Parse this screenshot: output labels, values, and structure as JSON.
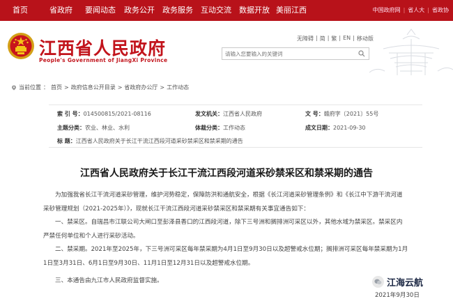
{
  "topnav": {
    "items": [
      "首页",
      "省政府",
      "要闻动态",
      "政务公开",
      "政务服务",
      "互动交流",
      "数据开放",
      "美丽江西"
    ],
    "right": [
      "中国政府网",
      "省人大",
      "省政协"
    ]
  },
  "header": {
    "title": "江西省人民政府",
    "subtitle": "People's Government of JiangXi Province",
    "toplinks": [
      "无障碍",
      "简",
      "繁",
      "EN",
      "移动版"
    ],
    "search_placeholder": "请输入您要输入的关键词"
  },
  "breadcrumb": {
    "current_label": "当前位置",
    "items": [
      "首页",
      "政府信息公开目录",
      "省政府办公厅",
      "工作动态"
    ]
  },
  "meta": {
    "index_label": "索 引 号：",
    "index_value": "014500815/2021-08116",
    "issuer_label": "发文机关：",
    "issuer_value": "江西省人民政府",
    "docno_label": "文 号：",
    "docno_value": "赣府字〔2021〕55号",
    "topic_label": "主题分类：",
    "topic_value": "农业、林业、水利",
    "category_label": "体裁分类：",
    "category_value": "工作动态",
    "date_label": "成文日期：",
    "date_value": "2021-09-30",
    "title_label": "标 题：",
    "title_value": "江西省人民政府关于长江干流江西段河道采砂禁采区和禁采期的通告"
  },
  "article": {
    "title": "江西省人民政府关于长江干流江西段河道采砂禁采区和禁采期的通告",
    "p1_line1": "为加强我省长江干流河道采砂管理，维护河势稳定，保障防洪和通航安全，根据《长江河道采砂管理条例》和《长江中下游干流河道",
    "p1_line2": "采砂管理规划（2021-2025年）》，现就长江干流江西段河道采砂禁采区和禁采期有关事宜通告如下：",
    "p2_line1": "一、禁采区。自瑞昌市江联公司大闸口至彭泽县香口的江西段河道，除下三号洲和搁排洲可采区以外，其他水域为禁采区。禁采区内",
    "p2_line2": "严禁任何单位和个人进行采砂活动。",
    "p3_line1": "二、禁采期。2021年至2025年，下三号洲可采区每年禁采期为4月1日至9月30日以及超警戒水位期；搁排洲可采区每年禁采期为1月",
    "p3_line2": "1日至3月31日、6月1日至9月30日、11月1日至12月31日以及超警戒水位期。",
    "p4": "三、本通告由九江市人民政府监督实施。",
    "date": "2021年9月30日"
  },
  "watermark": "江海云航",
  "colors": {
    "brand_red": "#b8121a",
    "title_red": "#c2141c"
  }
}
